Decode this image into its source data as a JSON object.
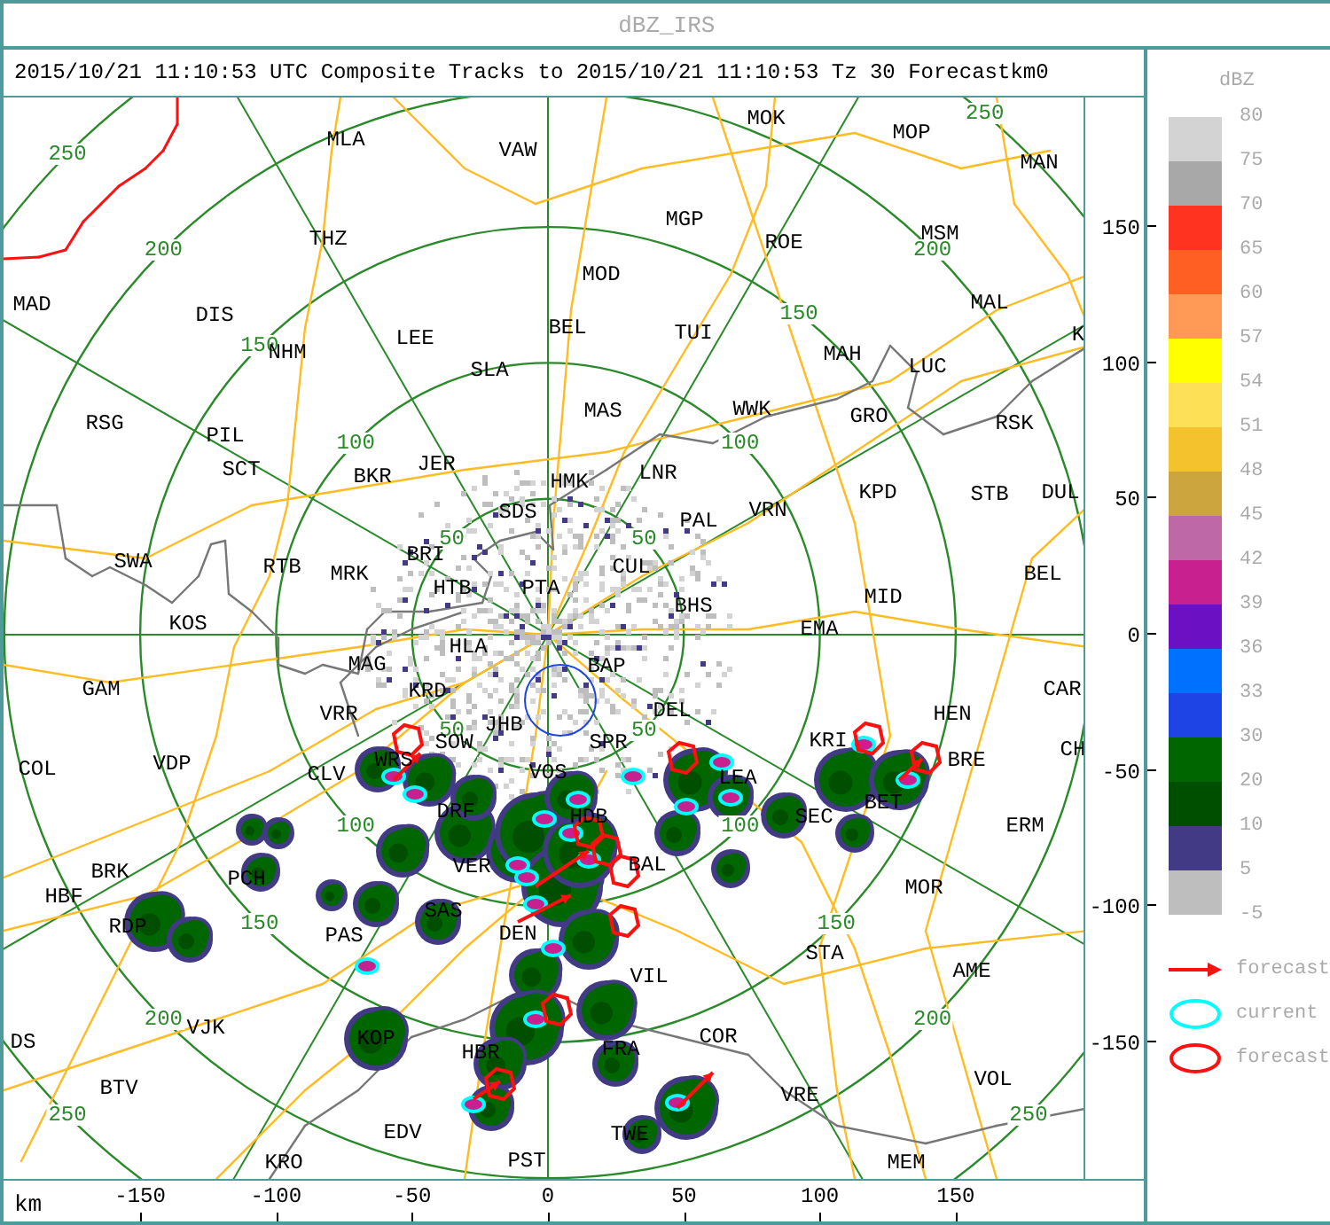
{
  "window": {
    "title": "dBZ_IRS"
  },
  "header": {
    "title": "2015/10/21 11:10:53 UTC Composite Tracks to 2015/10/21 11:10:53 Tz 30 Forecast",
    "y_unit": "km",
    "y_cut_label": "0"
  },
  "map": {
    "stations": [
      "MLA",
      "VAW",
      "MOK",
      "MOP",
      "MAN",
      "THZ",
      "MGP",
      "ROE",
      "MSM",
      "MOD",
      "MAD",
      "DIS",
      "MAL",
      "LEE",
      "BEL",
      "TUI",
      "K",
      "NHM",
      "SLA",
      "MAH",
      "LUC",
      "RSG",
      "PIL",
      "MAS",
      "WWK",
      "GRO",
      "RSK",
      "SCT",
      "BKR",
      "JER",
      "HMK",
      "LNR",
      "KPD",
      "STB",
      "DUL",
      "SDS",
      "PAL",
      "VRN",
      "SWA",
      "RTB",
      "MRK",
      "BRI",
      "CUL",
      "BEL",
      "HTB",
      "PTA",
      "BHS",
      "MID",
      "KOS",
      "HLA",
      "EMA",
      "GAM",
      "MAG",
      "KRD",
      "BAP",
      "CAR",
      "VRR",
      "JHB",
      "DEL",
      "HEN",
      "SOW",
      "SPR",
      "KRI",
      "CH",
      "COL",
      "VDP",
      "CLV",
      "WRS",
      "VOS",
      "LEA",
      "BRE",
      "DRF",
      "HDB",
      "SEC",
      "BET",
      "ERM",
      "HBF",
      "BRK",
      "PCH",
      "VER",
      "BAL",
      "MOR",
      "RDP",
      "PAS",
      "SAS",
      "DEN",
      "VIL",
      "STA",
      "AME",
      "DS",
      "VJK",
      "KOP",
      "HBR",
      "FRA",
      "COR",
      "BTV",
      "VRE",
      "VOL",
      "EDV",
      "TWE",
      "KRO",
      "PST",
      "MEM"
    ],
    "range_rings": [
      {
        "labels": [
          "50",
          "50",
          "50",
          "50"
        ]
      },
      {
        "labels": [
          "100",
          "100",
          "100",
          "100"
        ]
      },
      {
        "labels": [
          "150",
          "150",
          "150",
          "150"
        ]
      },
      {
        "labels": [
          "200",
          "200",
          "200",
          "200"
        ]
      },
      {
        "labels": [
          "250",
          "250",
          "250",
          "250"
        ]
      }
    ]
  },
  "x_axis": {
    "unit": "km",
    "ticks": [
      "-150",
      "-100",
      "-50",
      "0",
      "50",
      "100",
      "150"
    ]
  },
  "y_axis": {
    "ticks": [
      "150",
      "100",
      "50",
      "0",
      "-50",
      "-100",
      "-150"
    ]
  },
  "legend": {
    "title": "dBZ",
    "scale_labels": [
      "80",
      "75",
      "70",
      "65",
      "60",
      "57",
      "54",
      "51",
      "48",
      "45",
      "42",
      "39",
      "36",
      "33",
      "30",
      "20",
      "10",
      "5",
      "-5"
    ],
    "bins": [
      {
        "color": "#d3d3d3"
      },
      {
        "color": "#a8a8a8"
      },
      {
        "color": "#ff3320"
      },
      {
        "color": "#ff5f22"
      },
      {
        "color": "#ff9955"
      },
      {
        "color": "#ffff00"
      },
      {
        "color": "#fde055"
      },
      {
        "color": "#f4c22c"
      },
      {
        "color": "#cda53e"
      },
      {
        "color": "#bf68a8"
      },
      {
        "color": "#c8208f"
      },
      {
        "color": "#6c10c4"
      },
      {
        "color": "#0070ff"
      },
      {
        "color": "#1f44e6"
      },
      {
        "color": "#006600"
      },
      {
        "color": "#004e00"
      },
      {
        "color": "#423a85"
      },
      {
        "color": "#bebebe"
      }
    ],
    "symbols": [
      {
        "kind": "arrow",
        "label": "forecast"
      },
      {
        "kind": "current",
        "label": "current"
      },
      {
        "kind": "forecast",
        "label": "forecast"
      }
    ]
  }
}
